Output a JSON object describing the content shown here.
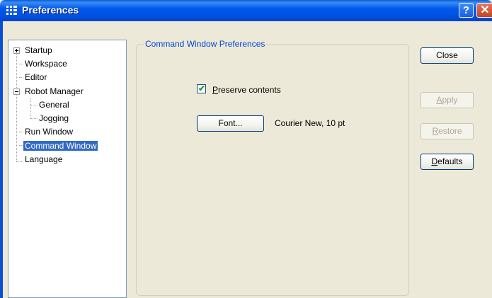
{
  "window": {
    "title": "Preferences",
    "help_glyph": "?",
    "close_glyph": "✕"
  },
  "tree": {
    "items": [
      {
        "label": "Startup",
        "expander": "plus"
      },
      {
        "label": "Workspace"
      },
      {
        "label": "Editor"
      },
      {
        "label": "Robot Manager",
        "expander": "minus"
      },
      {
        "label": "General"
      },
      {
        "label": "Jogging"
      },
      {
        "label": "Run Window"
      },
      {
        "label": "Command Window",
        "selected": true
      },
      {
        "label": "Language"
      }
    ]
  },
  "panel": {
    "legend": "Command Window Preferences",
    "preserve": {
      "checked": true,
      "label_mnemonic": "P",
      "label_rest": "reserve contents"
    },
    "font_button": "Font...",
    "font_value": "Courier New, 10 pt"
  },
  "buttons": {
    "close": "Close",
    "apply_mnemonic": "A",
    "apply_rest": "pply",
    "restore_mnemonic": "R",
    "restore_rest": "estore",
    "defaults_mnemonic": "D",
    "defaults_rest": "efaults"
  },
  "colors": {
    "titlebar": "#0058ee",
    "selection": "#316ac5",
    "legend_text": "#0046d5",
    "face": "#ece9d8"
  }
}
